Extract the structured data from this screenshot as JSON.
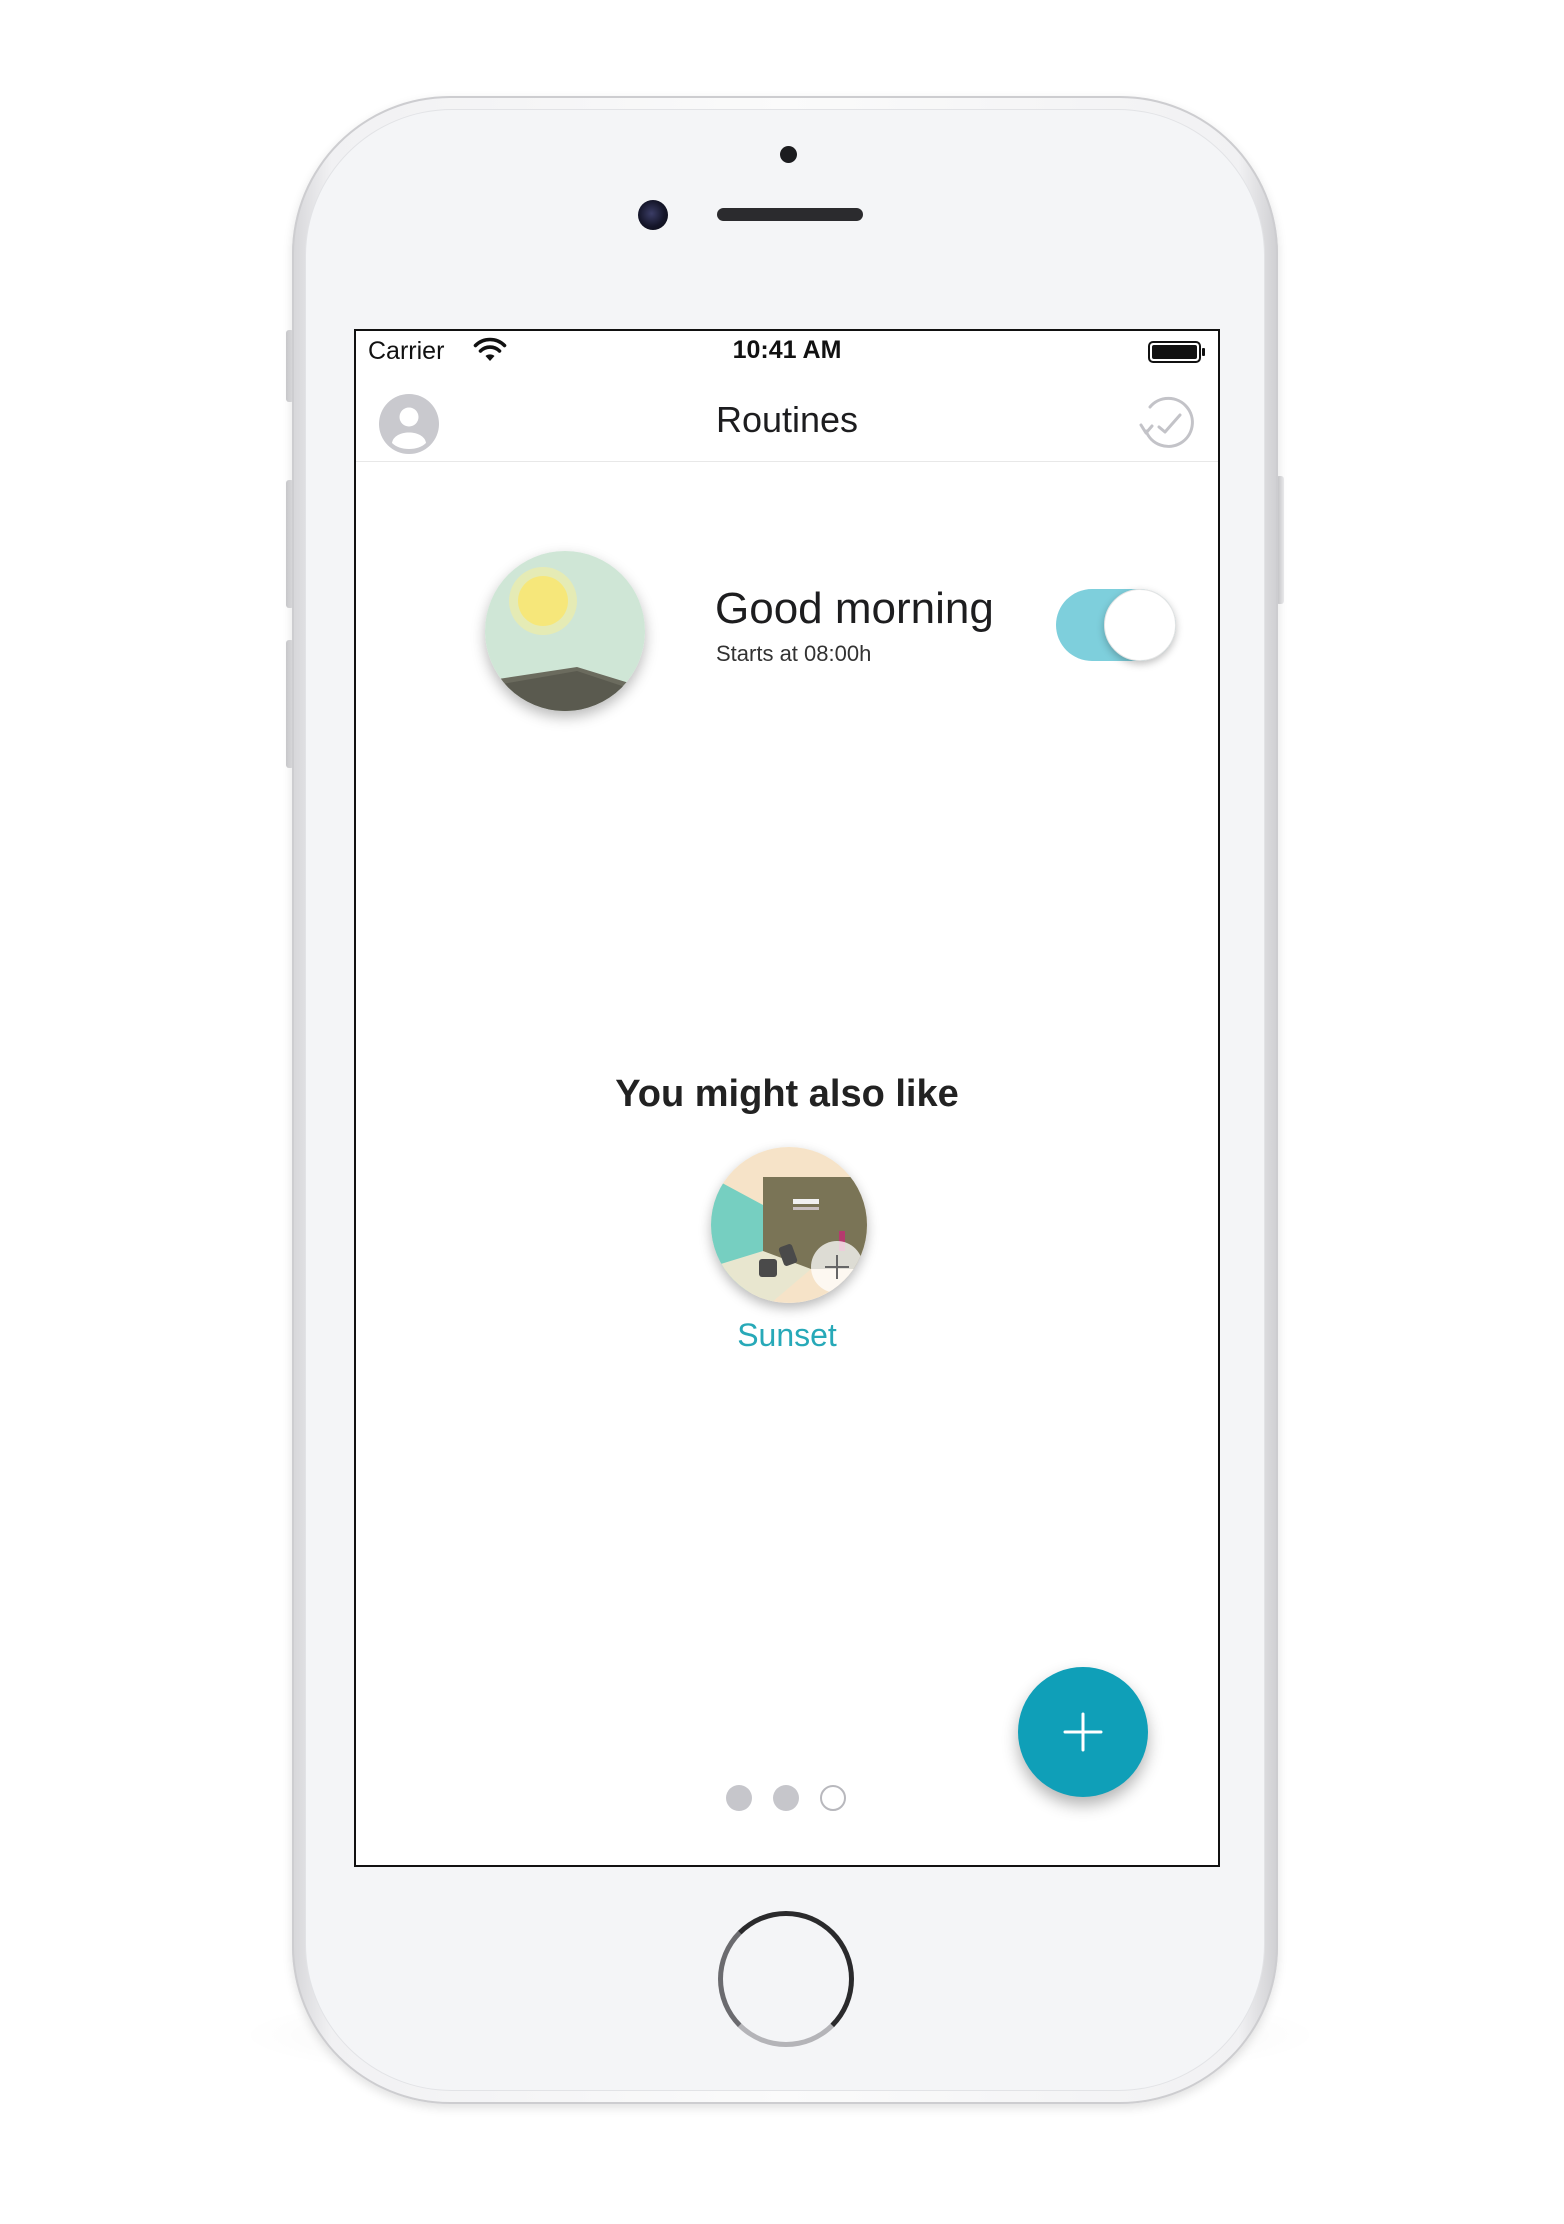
{
  "status_bar": {
    "carrier": "Carrier",
    "time": "10:41 AM",
    "wifi_icon": "wifi-icon",
    "battery_icon": "battery-full-icon"
  },
  "nav": {
    "title": "Routines",
    "left_icon": "profile-icon",
    "right_icon": "history-clock-icon"
  },
  "routines": [
    {
      "name": "Good morning",
      "subtitle": "Starts at 08:00h",
      "enabled": true,
      "thumb": "sunrise-illustration"
    }
  ],
  "suggestions": {
    "title": "You might also like",
    "items": [
      {
        "label": "Sunset",
        "thumb": "living-room-illustration",
        "add_icon": "plus-icon"
      }
    ]
  },
  "fab": {
    "icon": "plus-icon"
  },
  "pager": {
    "count": 3,
    "active_index": 2
  },
  "colors": {
    "accent": "#0f9fb8",
    "toggle_on": "#7ecfdc",
    "link": "#27a9b8",
    "dot": "#c6c6cb"
  }
}
